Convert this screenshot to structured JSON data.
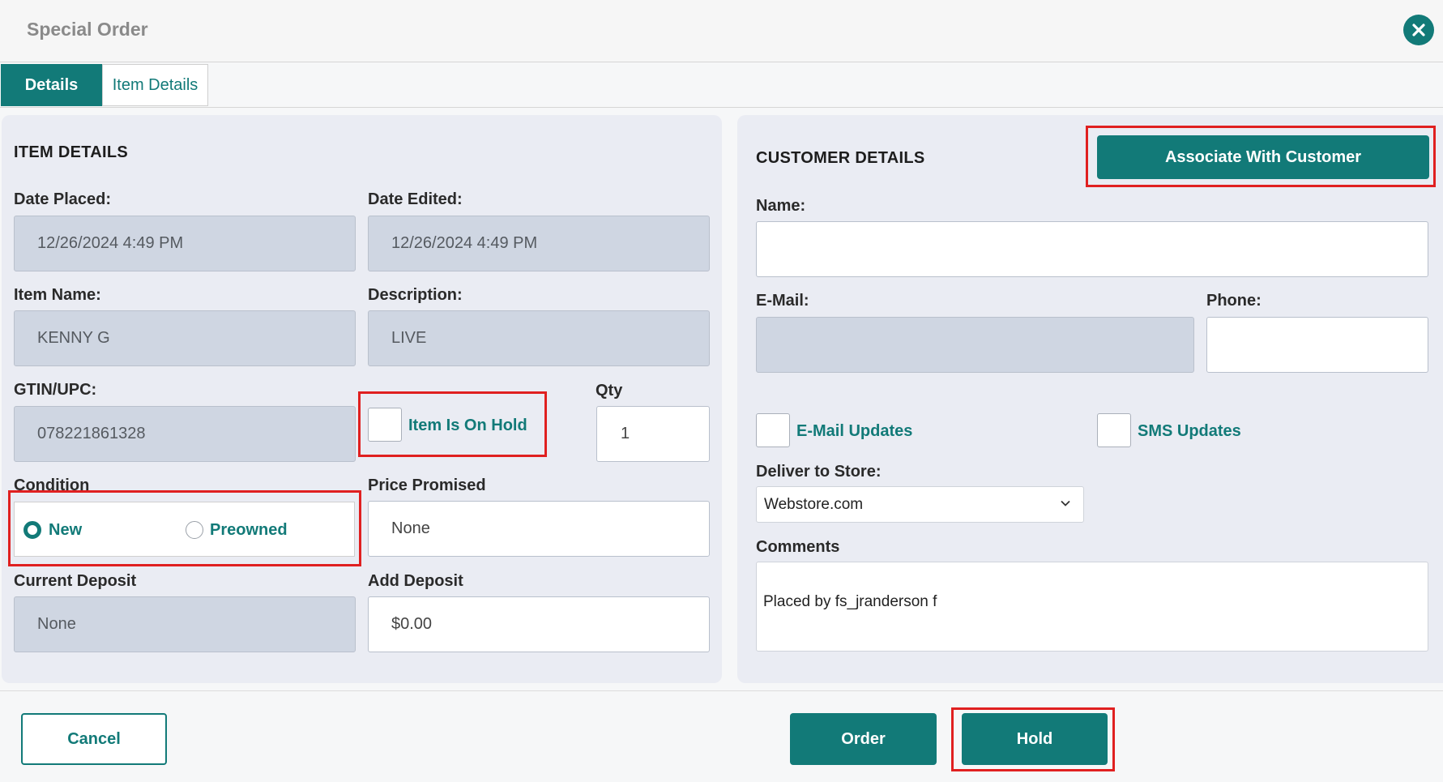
{
  "window": {
    "title": "Special Order",
    "close_icon": "close-icon"
  },
  "tabs": [
    {
      "label": "Details",
      "active": true
    },
    {
      "label": "Item Details",
      "active": false
    }
  ],
  "item_details": {
    "heading": "ITEM DETAILS",
    "date_placed": {
      "label": "Date Placed:",
      "value": "12/26/2024 4:49 PM"
    },
    "date_edited": {
      "label": "Date Edited:",
      "value": "12/26/2024 4:49 PM"
    },
    "item_name": {
      "label": "Item Name:",
      "value": "KENNY G"
    },
    "description": {
      "label": "Description:",
      "value": "LIVE"
    },
    "gtin": {
      "label": "GTIN/UPC:",
      "value": "078221861328"
    },
    "item_on_hold": {
      "label": "Item Is On Hold",
      "checked": false
    },
    "qty": {
      "label": "Qty",
      "value": "1"
    },
    "condition": {
      "label": "Condition",
      "options": [
        {
          "label": "New",
          "selected": true
        },
        {
          "label": "Preowned",
          "selected": false
        }
      ]
    },
    "price_promised": {
      "label": "Price Promised",
      "value": "None"
    },
    "current_deposit": {
      "label": "Current Deposit",
      "value": "None"
    },
    "add_deposit": {
      "label": "Add Deposit",
      "value": "$0.00"
    }
  },
  "customer_details": {
    "heading": "CUSTOMER DETAILS",
    "associate_button": "Associate With Customer",
    "name": {
      "label": "Name:",
      "value": ""
    },
    "email": {
      "label": "E-Mail:",
      "value": ""
    },
    "phone": {
      "label": "Phone:",
      "value": ""
    },
    "email_updates": {
      "label": "E-Mail Updates",
      "checked": false
    },
    "sms_updates": {
      "label": "SMS Updates",
      "checked": false
    },
    "deliver_to_store": {
      "label": "Deliver to Store:",
      "value": "Webstore.com"
    },
    "comments": {
      "label": "Comments",
      "value": "Placed by fs_jranderson f"
    }
  },
  "footer": {
    "cancel_label": "Cancel",
    "order_label": "Order",
    "hold_label": "Hold"
  },
  "colors": {
    "accent": "#127a78",
    "highlight": "#e02020",
    "readonly_field": "#cfd6e2",
    "panel": "#eaecf3"
  }
}
